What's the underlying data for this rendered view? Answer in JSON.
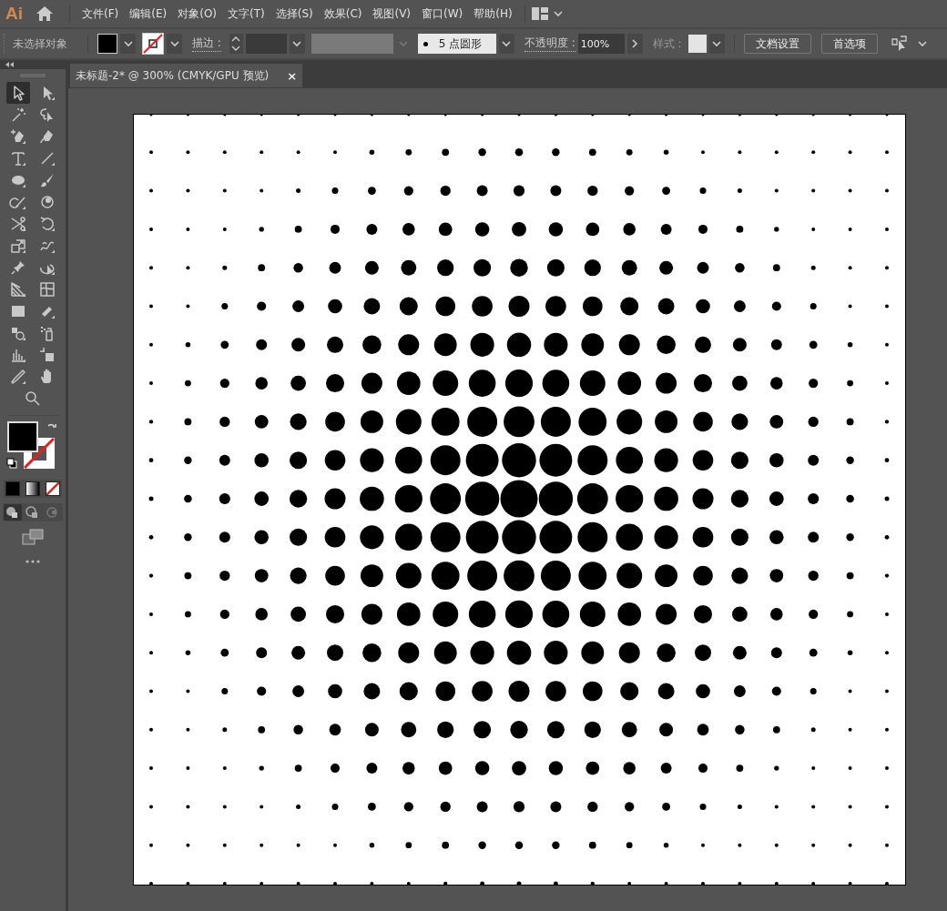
{
  "app": {
    "logo": "Ai"
  },
  "menu": [
    "文件(F)",
    "编辑(E)",
    "对象(O)",
    "文字(T)",
    "选择(S)",
    "效果(C)",
    "视图(V)",
    "窗口(W)",
    "帮助(H)"
  ],
  "control_bar": {
    "selection_status": "未选择对象",
    "stroke_label": "描边 :",
    "brush": "5 点圆形",
    "opacity_label": "不透明度 :",
    "opacity": "100%",
    "style_label": "样式 :",
    "buttons": [
      "文档设置",
      "首选项"
    ]
  },
  "document_tab": {
    "title": "未标题-2* @ 300% (CMYK/GPU 预览)",
    "close": "×",
    "selected": true
  },
  "tools": [
    {
      "kind": "selection",
      "selected": true
    },
    {
      "kind": "direct-selection",
      "selected": false
    },
    {
      "kind": "magic-wand",
      "selected": false
    },
    {
      "kind": "lasso",
      "selected": false
    },
    {
      "kind": "pen",
      "selected": false
    },
    {
      "kind": "curvature",
      "selected": false
    },
    {
      "kind": "type",
      "selected": false
    },
    {
      "kind": "line",
      "selected": false
    },
    {
      "kind": "ellipse",
      "selected": false
    },
    {
      "kind": "paintbrush",
      "selected": false
    },
    {
      "kind": "shaper",
      "selected": false
    },
    {
      "kind": "blob",
      "selected": false
    },
    {
      "kind": "scissors",
      "selected": false
    },
    {
      "kind": "rotate",
      "selected": false
    },
    {
      "kind": "scale",
      "selected": false
    },
    {
      "kind": "warp",
      "selected": false
    },
    {
      "kind": "puppet",
      "selected": false
    },
    {
      "kind": "free-transform",
      "selected": false
    },
    {
      "kind": "perspective",
      "selected": false
    },
    {
      "kind": "mesh",
      "selected": false
    },
    {
      "kind": "gradient",
      "selected": false
    },
    {
      "kind": "ruler",
      "selected": false
    },
    {
      "kind": "shape-builder",
      "selected": false
    },
    {
      "kind": "sprayer",
      "selected": false
    },
    {
      "kind": "graph",
      "selected": false
    },
    {
      "kind": "artboard",
      "selected": false
    },
    {
      "kind": "eyedropper",
      "selected": false
    },
    {
      "kind": "hand",
      "selected": false
    },
    {
      "kind": "zoom",
      "selected": false
    }
  ]
}
